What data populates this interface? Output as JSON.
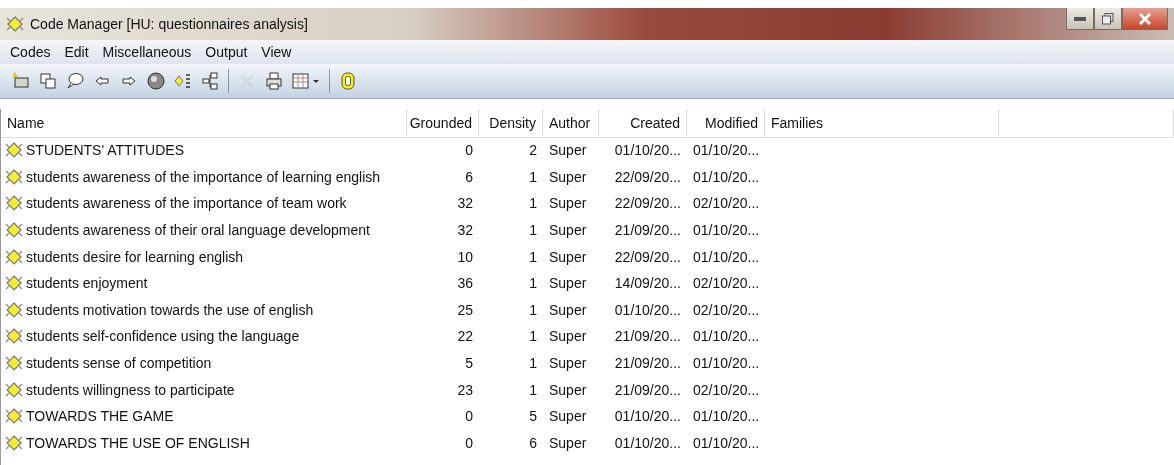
{
  "window": {
    "title": "Code Manager [HU: questionnaires analysis]"
  },
  "menu": [
    "Codes",
    "Edit",
    "Miscellaneous",
    "Output",
    "View"
  ],
  "toolbar": [
    {
      "kind": "new",
      "disabled": false
    },
    {
      "kind": "copy",
      "disabled": false
    },
    {
      "kind": "comment",
      "disabled": false
    },
    {
      "kind": "back",
      "disabled": false
    },
    {
      "kind": "forward",
      "disabled": false
    },
    {
      "kind": "sphere",
      "disabled": false
    },
    {
      "kind": "split",
      "disabled": false
    },
    {
      "kind": "tree",
      "disabled": false
    },
    {
      "kind": "separator"
    },
    {
      "kind": "delete",
      "disabled": true
    },
    {
      "kind": "print",
      "disabled": false
    },
    {
      "kind": "grid",
      "disabled": false
    },
    {
      "kind": "separator"
    },
    {
      "kind": "ring",
      "disabled": false
    }
  ],
  "table": {
    "columns": [
      "Name",
      "Grounded",
      "Density",
      "Author",
      "Created",
      "Modified",
      "Families"
    ],
    "rows": [
      [
        "STUDENTS' ATTITUDES",
        "0",
        "2",
        "Super",
        "01/10/20...",
        "01/10/20..."
      ],
      [
        "students awareness of the importance of learning english",
        "6",
        "1",
        "Super",
        "22/09/20...",
        "01/10/20..."
      ],
      [
        "students awareness of the importance of team work",
        "32",
        "1",
        "Super",
        "22/09/20...",
        "02/10/20..."
      ],
      [
        "students awareness of their oral language development",
        "32",
        "1",
        "Super",
        "21/09/20...",
        "01/10/20..."
      ],
      [
        "students desire for learning english",
        "10",
        "1",
        "Super",
        "22/09/20...",
        "01/10/20..."
      ],
      [
        "students enjoyment",
        "36",
        "1",
        "Super",
        "14/09/20...",
        "02/10/20..."
      ],
      [
        "students motivation towards the use of english",
        "25",
        "1",
        "Super",
        "01/10/20...",
        "02/10/20..."
      ],
      [
        "students self-confidence using the language",
        "22",
        "1",
        "Super",
        "21/09/20...",
        "01/10/20..."
      ],
      [
        "students sense of competition",
        "5",
        "1",
        "Super",
        "21/09/20...",
        "01/10/20..."
      ],
      [
        "students willingness to participate",
        "23",
        "1",
        "Super",
        "21/09/20...",
        "02/10/20..."
      ],
      [
        "TOWARDS THE GAME",
        "0",
        "5",
        "Super",
        "01/10/20...",
        "01/10/20..."
      ],
      [
        "TOWARDS THE USE OF ENGLISH",
        "0",
        "6",
        "Super",
        "01/10/20...",
        "01/10/20..."
      ]
    ]
  }
}
